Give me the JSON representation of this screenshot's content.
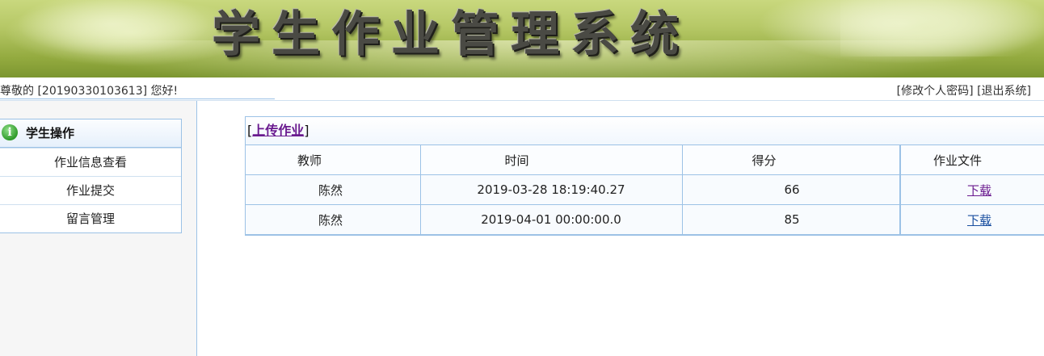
{
  "banner": {
    "title": "学生作业管理系统"
  },
  "topbar": {
    "welcome": "尊敬的 [20190330103613] 您好!",
    "change_password": "[修改个人密码]",
    "logout": "[退出系统]"
  },
  "sidebar": {
    "header": "学生操作",
    "header_icon": "info-icon",
    "items": [
      {
        "label": "作业信息查看"
      },
      {
        "label": "作业提交"
      },
      {
        "label": "留言管理"
      }
    ]
  },
  "main": {
    "upload_prefix": "[",
    "upload_link": "上传作业",
    "upload_suffix": "]",
    "columns": [
      "教师",
      "时间",
      "得分",
      "作业文件"
    ],
    "rows": [
      {
        "teacher": "陈然",
        "time": "2019-03-28 18:19:40.27",
        "score": "66",
        "file": "下载",
        "file_color": "#6a1b8f"
      },
      {
        "teacher": "陈然",
        "time": "2019-04-01 00:00:00.0",
        "score": "85",
        "file": "下载",
        "file_color": "#1a4fa0"
      }
    ]
  },
  "colors": {
    "border": "#9cc2e6",
    "visited_link": "#6a1b8f",
    "link": "#1a4fa0",
    "banner_green": "#93aa3f"
  }
}
